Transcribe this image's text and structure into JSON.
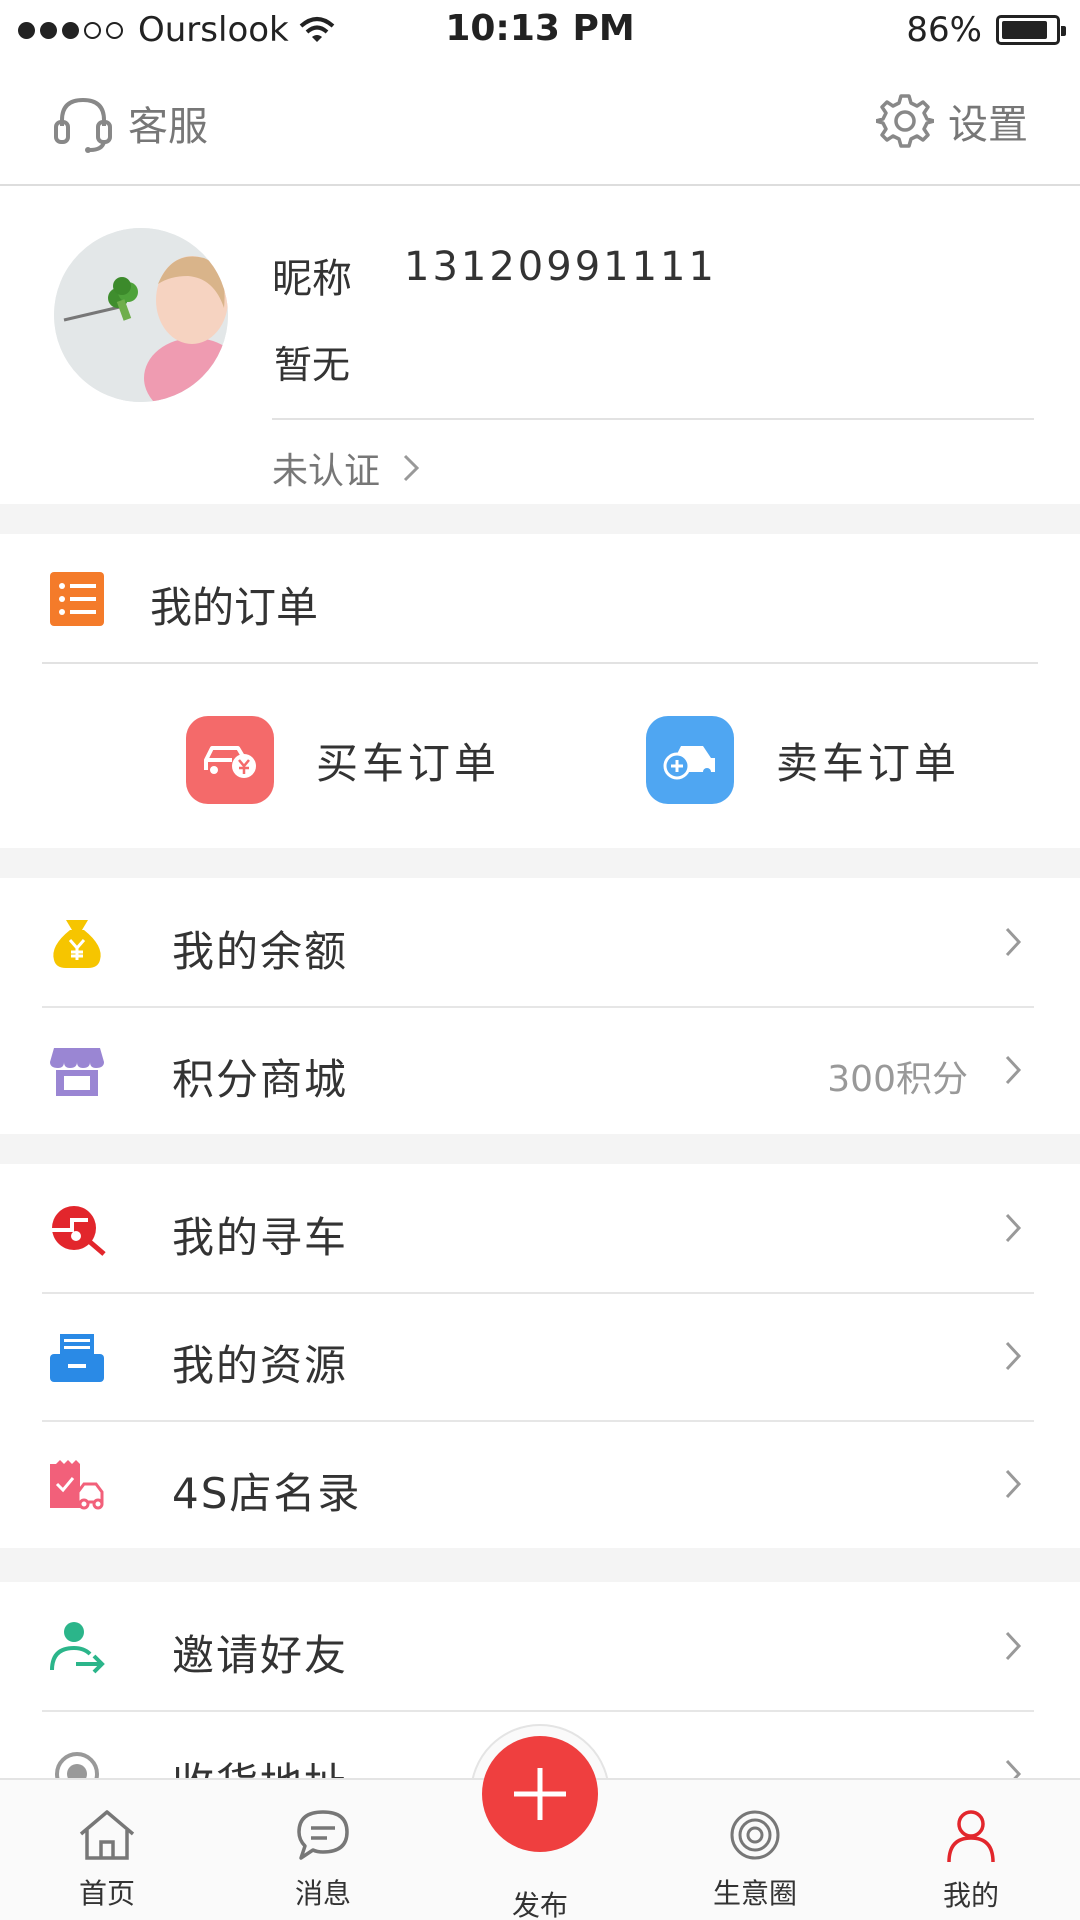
{
  "status_bar": {
    "carrier": "Ourslook",
    "time": "10:13 PM",
    "battery": "86%",
    "battery_level": 0.86
  },
  "header": {
    "service_label": "客服",
    "service_icon": "headset-icon",
    "settings_label": "设置",
    "settings_icon": "gear-icon"
  },
  "profile": {
    "nickname": "昵称",
    "phone": "13120991111",
    "description": "暂无",
    "certification": "未认证"
  },
  "orders": {
    "title": "我的订单",
    "buy_label": "买车订单",
    "sell_label": "卖车订单"
  },
  "groups": [
    [
      {
        "label": "我的余额",
        "icon": "money-bag-icon",
        "extra": ""
      },
      {
        "label": "积分商城",
        "icon": "store-icon",
        "extra": "300积分"
      }
    ],
    [
      {
        "label": "我的寻车",
        "icon": "car-search-icon",
        "extra": ""
      },
      {
        "label": "我的资源",
        "icon": "tray-icon",
        "extra": ""
      },
      {
        "label": "4S店名录",
        "icon": "dealer-directory-icon",
        "extra": ""
      }
    ],
    [
      {
        "label": "邀请好友",
        "icon": "invite-friend-icon",
        "extra": ""
      },
      {
        "label": "收货地址",
        "icon": "location-icon",
        "extra": ""
      }
    ]
  ],
  "tabbar": {
    "home": "首页",
    "messages": "消息",
    "publish": "发布",
    "business": "生意圈",
    "mine": "我的",
    "active": "mine"
  },
  "colors": {
    "accent_red": "#ef3f3f",
    "orders_orange": "#f47b2a",
    "buy_red": "#f46a6a",
    "sell_blue": "#4fa6f2",
    "invite_green": "#2bb58a"
  }
}
